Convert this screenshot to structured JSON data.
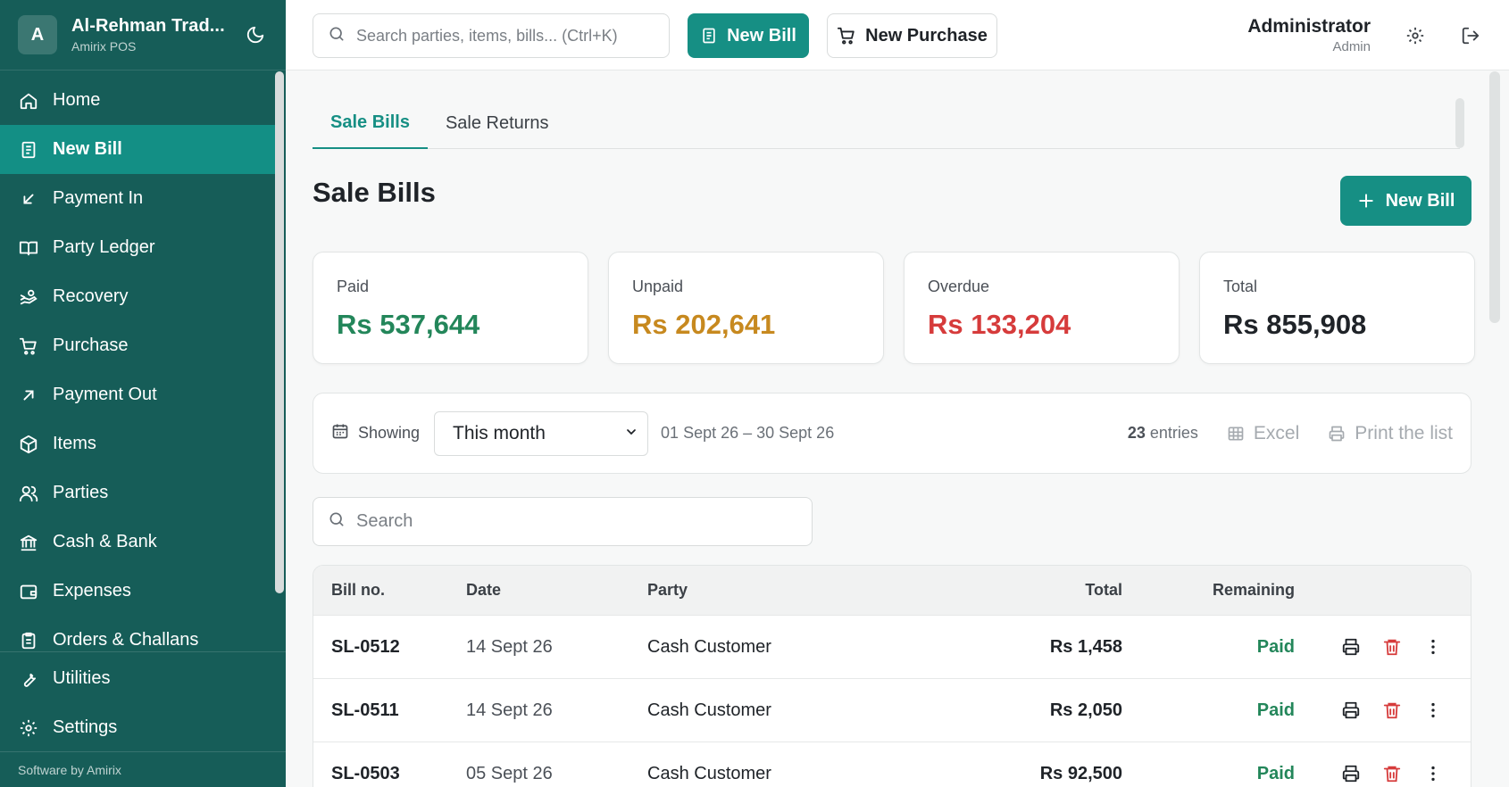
{
  "brand": {
    "initial": "A",
    "name": "Al-Rehman Trad...",
    "subtitle": "Amirix POS"
  },
  "sidebar": {
    "items": [
      {
        "label": "Home",
        "icon": "home-icon",
        "active": false
      },
      {
        "label": "New Bill",
        "icon": "receipt-icon",
        "active": true
      },
      {
        "label": "Payment In",
        "icon": "arrow-down-left-icon",
        "active": false
      },
      {
        "label": "Party Ledger",
        "icon": "book-open-icon",
        "active": false
      },
      {
        "label": "Recovery",
        "icon": "hand-coins-icon",
        "active": false
      },
      {
        "label": "Purchase",
        "icon": "cart-icon",
        "active": false
      },
      {
        "label": "Payment Out",
        "icon": "arrow-up-right-icon",
        "active": false
      },
      {
        "label": "Items",
        "icon": "box-icon",
        "active": false
      },
      {
        "label": "Parties",
        "icon": "users-icon",
        "active": false
      },
      {
        "label": "Cash & Bank",
        "icon": "bank-icon",
        "active": false
      },
      {
        "label": "Expenses",
        "icon": "wallet-icon",
        "active": false
      },
      {
        "label": "Orders & Challans",
        "icon": "clipboard-icon",
        "active": false
      }
    ],
    "bottom_items": [
      {
        "label": "Utilities",
        "icon": "wrench-icon"
      },
      {
        "label": "Settings",
        "icon": "gear-icon"
      }
    ],
    "footer": "Software by Amirix"
  },
  "topbar": {
    "search_placeholder": "Search parties, items, bills... (Ctrl+K)",
    "new_bill_label": "New Bill",
    "new_purchase_label": "New Purchase",
    "user_name": "Administrator",
    "user_role": "Admin"
  },
  "tabs": [
    {
      "label": "Sale Bills",
      "active": true
    },
    {
      "label": "Sale Returns",
      "active": false
    }
  ],
  "page": {
    "title": "Sale Bills",
    "new_button": "New Bill"
  },
  "stats": [
    {
      "label": "Paid",
      "value": "Rs 537,644",
      "color": "#23865a"
    },
    {
      "label": "Unpaid",
      "value": "Rs 202,641",
      "color": "#c7891f"
    },
    {
      "label": "Overdue",
      "value": "Rs 133,204",
      "color": "#d63b3b"
    },
    {
      "label": "Total",
      "value": "Rs 855,908",
      "color": "#1f2328"
    }
  ],
  "filter": {
    "showing_label": "Showing",
    "period_value": "This month",
    "date_range": "01 Sept 26 – 30 Sept 26",
    "entries_count": "23",
    "entries_label": "entries",
    "excel_label": "Excel",
    "print_label": "Print the list"
  },
  "table_search_placeholder": "Search",
  "table": {
    "columns": {
      "bill": "Bill no.",
      "date": "Date",
      "party": "Party",
      "total": "Total",
      "remaining": "Remaining"
    },
    "rows": [
      {
        "bill": "SL-0512",
        "date": "14 Sept 26",
        "party": "Cash Customer",
        "total": "Rs 1,458",
        "remaining": "Paid"
      },
      {
        "bill": "SL-0511",
        "date": "14 Sept 26",
        "party": "Cash Customer",
        "total": "Rs 2,050",
        "remaining": "Paid"
      },
      {
        "bill": "SL-0503",
        "date": "05 Sept 26",
        "party": "Cash Customer",
        "total": "Rs 92,500",
        "remaining": "Paid"
      }
    ]
  },
  "colors": {
    "sidebar": "#165d58",
    "accent": "#168f84",
    "paid": "#23865a",
    "delete": "#d63b3b"
  }
}
